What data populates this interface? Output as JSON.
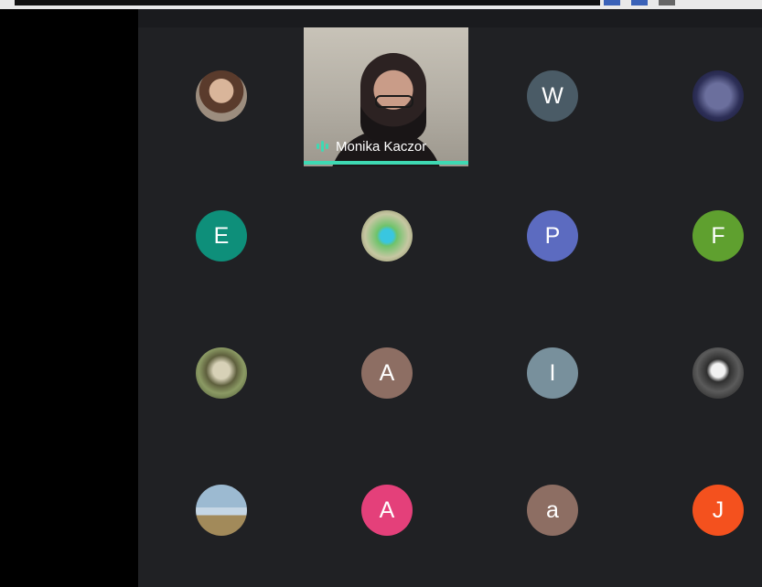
{
  "speaker": {
    "name": "Monika Kaczor",
    "indicator_color": "#3ed9b3"
  },
  "participants": [
    {
      "id": "p1",
      "kind": "photo",
      "style": "photo-a"
    },
    {
      "id": "p2",
      "kind": "letter",
      "letter": "W",
      "color": "#4a5b66"
    },
    {
      "id": "p3",
      "kind": "photo",
      "style": "photo-b"
    },
    {
      "id": "p4",
      "kind": "letter",
      "letter": "E",
      "color": "#0e8f7a"
    },
    {
      "id": "p5",
      "kind": "photo",
      "style": "photo-c"
    },
    {
      "id": "p6",
      "kind": "letter",
      "letter": "P",
      "color": "#5c6bc0"
    },
    {
      "id": "p7",
      "kind": "letter",
      "letter": "F",
      "color": "#5fa02f"
    },
    {
      "id": "p8",
      "kind": "photo",
      "style": "photo-d"
    },
    {
      "id": "p9",
      "kind": "letter",
      "letter": "A",
      "color": "#8d6e63"
    },
    {
      "id": "p10",
      "kind": "letter",
      "letter": "I",
      "color": "#78909c"
    },
    {
      "id": "p11",
      "kind": "photo",
      "style": "photo-e"
    },
    {
      "id": "p12",
      "kind": "photo",
      "style": "photo-f"
    },
    {
      "id": "p13",
      "kind": "letter",
      "letter": "A",
      "color": "#e4407a"
    },
    {
      "id": "p14",
      "kind": "letter",
      "letter": "a",
      "color": "#8d6e63"
    },
    {
      "id": "p15",
      "kind": "letter",
      "letter": "J",
      "color": "#f4511e"
    }
  ]
}
